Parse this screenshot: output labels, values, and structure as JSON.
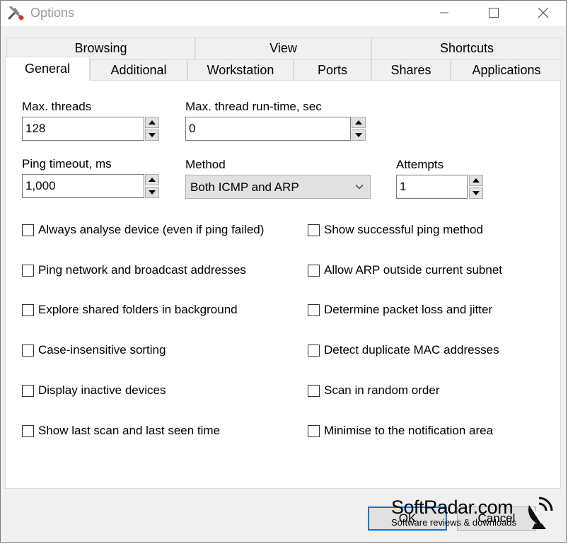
{
  "window": {
    "title": "Options",
    "icon": "tools-icon",
    "controls": [
      "minimize-icon",
      "maximize-icon",
      "close-icon"
    ]
  },
  "tabs": {
    "row1": [
      "Browsing",
      "View",
      "Shortcuts"
    ],
    "row2": [
      "General",
      "Additional",
      "Workstation",
      "Ports",
      "Shares",
      "Applications"
    ],
    "active": "General"
  },
  "general": {
    "max_threads": {
      "label": "Max. threads",
      "value": "128"
    },
    "max_runtime": {
      "label": "Max. thread run-time, sec",
      "value": "0"
    },
    "ping_timeout": {
      "label": "Ping timeout, ms",
      "value": "1,000"
    },
    "method": {
      "label": "Method",
      "value": "Both ICMP and ARP"
    },
    "attempts": {
      "label": "Attempts",
      "value": "1"
    },
    "checkboxes_left": [
      {
        "label": "Always analyse device (even if ping failed)",
        "checked": false
      },
      {
        "label": "Ping network and broadcast addresses",
        "checked": false
      },
      {
        "label": "Explore shared folders in background",
        "checked": false
      },
      {
        "label": "Case-insensitive sorting",
        "checked": false
      },
      {
        "label": "Display inactive devices",
        "checked": false
      },
      {
        "label": "Show last scan and last seen time",
        "checked": false
      }
    ],
    "checkboxes_right": [
      {
        "label": "Show successful ping method",
        "checked": false
      },
      {
        "label": "Allow ARP outside current subnet",
        "checked": false
      },
      {
        "label": "Determine packet loss and jitter",
        "checked": false
      },
      {
        "label": "Detect duplicate MAC addresses",
        "checked": false
      },
      {
        "label": "Scan in random order",
        "checked": false
      },
      {
        "label": "Minimise to the notification area",
        "checked": false
      }
    ]
  },
  "footer": {
    "ok_label": "OK",
    "cancel_label": "Cancel"
  },
  "watermark": {
    "name": "SoftRadar.com",
    "tagline": "Software reviews & downloads",
    "icon": "satellite-dish-icon"
  },
  "colors": {
    "accent": "#0078d7",
    "panel_bg": "#ffffff",
    "window_bg": "#f0f0f0",
    "button_bg": "#e1e1e1"
  }
}
